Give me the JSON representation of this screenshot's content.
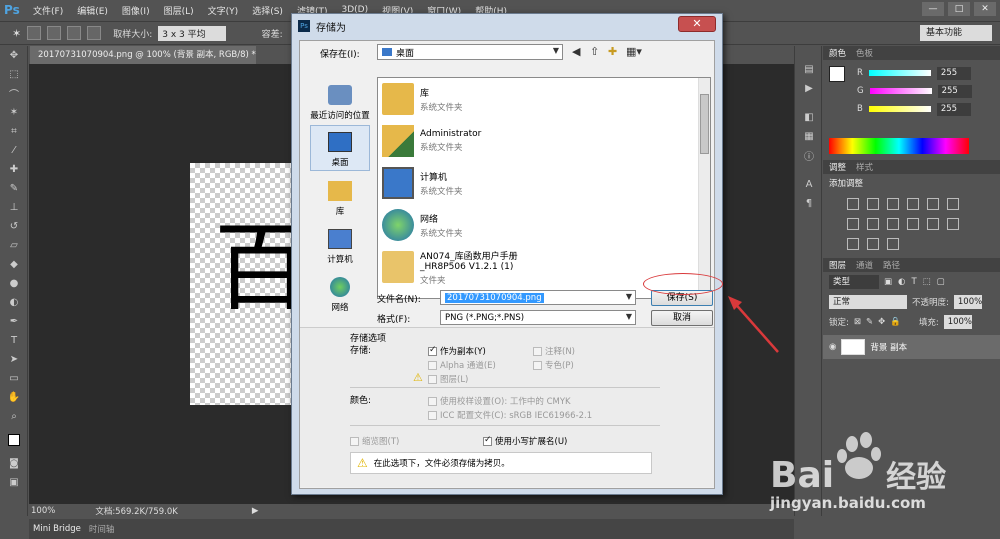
{
  "app": {
    "logo": "Ps",
    "menus": [
      "文件(F)",
      "编辑(E)",
      "图像(I)",
      "图层(L)",
      "文字(Y)",
      "选择(S)",
      "滤镜(T)",
      "3D(D)",
      "视图(V)",
      "窗口(W)",
      "帮助(H)"
    ],
    "window_controls": [
      "—",
      "□",
      "✕"
    ]
  },
  "options_bar": {
    "sample_size_label": "取样大小:",
    "sample_size_value": "3 x 3 平均",
    "tolerance_label": "容差:",
    "workspace": "基本功能"
  },
  "document": {
    "tab_title": "20170731070904.png @ 100% (背景 副本, RGB/8) *",
    "canvas_char": "百",
    "zoom": "100%",
    "doc_size": "文档:569.2K/759.0K"
  },
  "bottom_tabs": [
    "Mini Bridge",
    "时间轴"
  ],
  "panels": {
    "color_tabs": [
      "颜色",
      "色板"
    ],
    "rgb": [
      {
        "label": "R",
        "value": "255"
      },
      {
        "label": "G",
        "value": "255"
      },
      {
        "label": "B",
        "value": "255"
      }
    ],
    "adjust_tabs": [
      "调整",
      "样式"
    ],
    "adjust_title": "添加调整",
    "layers_tabs": [
      "图层",
      "通道",
      "路径"
    ],
    "filter_kind": "类型",
    "blend_mode": "正常",
    "opacity_label": "不透明度:",
    "opacity": "100%",
    "lock_label": "锁定:",
    "fill_label": "填充:",
    "fill": "100%",
    "layer_name": "背景 副本"
  },
  "dialog": {
    "title": "存储为",
    "close": "✕",
    "save_in_label": "保存在(I):",
    "save_in_value": "桌面",
    "places": [
      {
        "label": "最近访问的位置",
        "icon": "recent-places-icon"
      },
      {
        "label": "桌面",
        "icon": "desktop-icon"
      },
      {
        "label": "库",
        "icon": "library-icon"
      },
      {
        "label": "计算机",
        "icon": "computer-icon"
      },
      {
        "label": "网络",
        "icon": "network-icon"
      }
    ],
    "files": [
      {
        "name": "库",
        "type": "系统文件夹",
        "icon": "library-folder-icon"
      },
      {
        "name": "Administrator",
        "type": "系统文件夹",
        "icon": "user-folder-icon"
      },
      {
        "name": "计算机",
        "type": "系统文件夹",
        "icon": "computer-icon"
      },
      {
        "name": "网络",
        "type": "系统文件夹",
        "icon": "network-globe-icon"
      },
      {
        "name": "AN074_库函数用户手册\n_HR8P506 V1.2.1 (1)",
        "type": "文件夹",
        "icon": "folder-icon"
      }
    ],
    "filename_label": "文件名(N):",
    "filename_value": "20170731070904.png",
    "format_label": "格式(F):",
    "format_value": "PNG (*.PNG;*.PNS)",
    "save_button": "保存(S)",
    "cancel_button": "取消",
    "save_options_title": "存储选项",
    "save_label": "存储:",
    "opt_as_copy": "作为副本(Y)",
    "opt_alpha": "Alpha 通道(E)",
    "opt_layers": "图层(L)",
    "opt_notes": "注释(N)",
    "opt_spot": "专色(P)",
    "color_label": "颜色:",
    "opt_proof": "使用校样设置(O): 工作中的 CMYK",
    "opt_icc": "ICC 配置文件(C): sRGB IEC61966-2.1",
    "opt_thumbnail": "缩览图(T)",
    "opt_lowercase": "使用小写扩展名(U)",
    "warning": "在此选项下，文件必须存储为拷贝。"
  },
  "watermark": {
    "brand": "Bai",
    "brand_cn": "经验",
    "url": "jingyan.baidu.com"
  }
}
